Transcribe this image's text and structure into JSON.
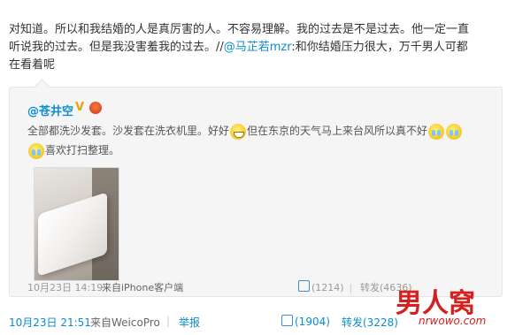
{
  "post": {
    "line1": "对知道。所以和我结婚的人是真厉害的人。不容易理解。我的过去是不是过去。他一定一直",
    "line2_a": "听说我的过去。但是我没害羞我的过去。//",
    "mention": "@马芷若mzr",
    "line2_b": ":和你结婚压力很大，万千男人可都",
    "line3": "在看着呢"
  },
  "quote": {
    "author": "@苍井空",
    "v_badge": "V",
    "text1": "全部都洗沙发套。沙发套在洗衣机里。好好",
    "text2": "但在东京的天气马上来台风所以真不好",
    "text3": "喜欢打扫整理。",
    "emoji_names": [
      "grin-icon",
      "cry-icon",
      "cry-icon",
      "cry-icon"
    ],
    "footer": {
      "time": "10月23日 14:19",
      "source_label": "来自iPhone客户端",
      "like": "(1214)",
      "repost": "转发(4636)",
      "sep": "|"
    }
  },
  "footer": {
    "time": "10月23日 21:51",
    "source_label": "来自WeicoPro",
    "sep": "|",
    "report": "举报",
    "like": "(1904)",
    "repost": "转发(3228)"
  },
  "watermark": {
    "logo": "男人窝",
    "url": "nrwowo.com"
  },
  "colors": {
    "link": "#0a8cd2",
    "quote_bg": "#f5f5f5",
    "watermark": "#d61f1f"
  }
}
